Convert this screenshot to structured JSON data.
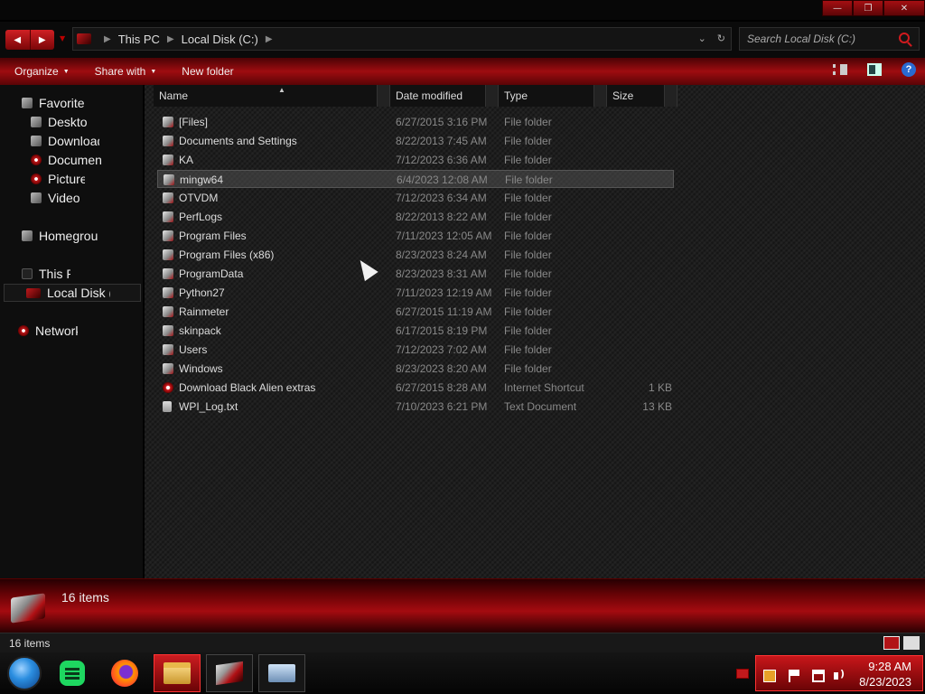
{
  "address": {
    "crumbs": [
      "This PC",
      "Local Disk (C:)"
    ],
    "search_placeholder": "Search Local Disk (C:)"
  },
  "toolbar": {
    "organize": "Organize",
    "share_with": "Share with",
    "new_folder": "New folder"
  },
  "nav": {
    "favorites": "Favorite",
    "desktop": "Desktop",
    "downloads": "Downloads",
    "documents": "Documents",
    "pictures": "Pictures",
    "videos": "Videos",
    "homegroup": "Homegroup",
    "this_pc": "This PC",
    "local_disk": "Local Disk (C:)",
    "network": "Network"
  },
  "columns": {
    "name": "Name",
    "date_modified": "Date modified",
    "type": "Type",
    "size": "Size"
  },
  "files": [
    {
      "name": "[Files]",
      "date": "6/27/2015 3:16 PM",
      "type": "File folder",
      "size": "",
      "icon": "folder-icon"
    },
    {
      "name": "Documents and Settings",
      "date": "8/22/2013 7:45 AM",
      "type": "File folder",
      "size": "",
      "icon": "folder-icon"
    },
    {
      "name": "KA",
      "date": "7/12/2023 6:36 AM",
      "type": "File folder",
      "size": "",
      "icon": "folder-icon"
    },
    {
      "name": "mingw64",
      "date": "6/4/2023 12:08 AM",
      "type": "File folder",
      "size": "",
      "icon": "folder-icon"
    },
    {
      "name": "OTVDM",
      "date": "7/12/2023 6:34 AM",
      "type": "File folder",
      "size": "",
      "icon": "folder-icon"
    },
    {
      "name": "PerfLogs",
      "date": "8/22/2013 8:22 AM",
      "type": "File folder",
      "size": "",
      "icon": "folder-icon"
    },
    {
      "name": "Program Files",
      "date": "7/11/2023 12:05 AM",
      "type": "File folder",
      "size": "",
      "icon": "folder-icon"
    },
    {
      "name": "Program Files (x86)",
      "date": "8/23/2023 8:24 AM",
      "type": "File folder",
      "size": "",
      "icon": "folder-icon"
    },
    {
      "name": "ProgramData",
      "date": "8/23/2023 8:31 AM",
      "type": "File folder",
      "size": "",
      "icon": "folder-icon"
    },
    {
      "name": "Python27",
      "date": "7/11/2023 12:19 AM",
      "type": "File folder",
      "size": "",
      "icon": "folder-icon"
    },
    {
      "name": "Rainmeter",
      "date": "6/27/2015 11:19 AM",
      "type": "File folder",
      "size": "",
      "icon": "folder-icon"
    },
    {
      "name": "skinpack",
      "date": "6/17/2015 8:19 PM",
      "type": "File folder",
      "size": "",
      "icon": "folder-icon"
    },
    {
      "name": "Users",
      "date": "7/12/2023 7:02 AM",
      "type": "File folder",
      "size": "",
      "icon": "folder-icon"
    },
    {
      "name": "Windows",
      "date": "8/23/2023 8:20 AM",
      "type": "File folder",
      "size": "",
      "icon": "folder-icon"
    },
    {
      "name": "Download Black Alien extras",
      "date": "6/27/2015 8:28 AM",
      "type": "Internet Shortcut",
      "size": "1 KB",
      "icon": "internet-shortcut-icon"
    },
    {
      "name": "WPI_Log.txt",
      "date": "7/10/2023 6:21 PM",
      "type": "Text Document",
      "size": "13 KB",
      "icon": "text-document-icon"
    }
  ],
  "details_pane": {
    "item_count": "16 items"
  },
  "statusbar": {
    "item_count": "16 items"
  },
  "clock": {
    "time": "9:28 AM",
    "date": "8/23/2023"
  },
  "theme": {
    "accent": "#b11317",
    "background": "#1e1e1e"
  }
}
